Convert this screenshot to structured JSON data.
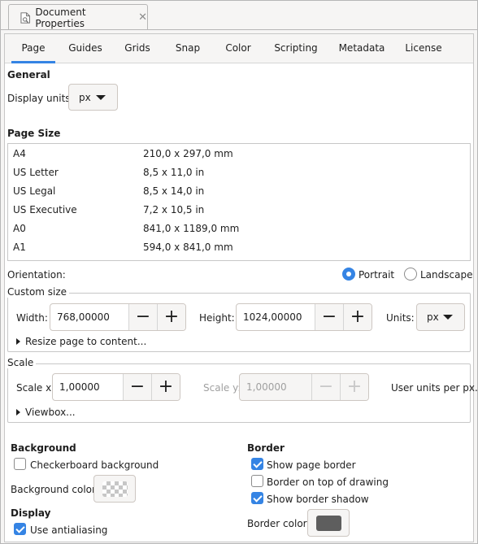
{
  "window": {
    "tab_title": "Document Properties"
  },
  "tabs": [
    "Page",
    "Guides",
    "Grids",
    "Snap",
    "Color",
    "Scripting",
    "Metadata",
    "License"
  ],
  "general": {
    "heading": "General",
    "display_units_label": "Display units:",
    "display_units_value": "px"
  },
  "page_size": {
    "heading": "Page Size",
    "rows": [
      {
        "name": "A4",
        "size": "210,0 x 297,0 mm"
      },
      {
        "name": "US Letter",
        "size": "8,5 x 11,0 in"
      },
      {
        "name": "US Legal",
        "size": "8,5 x 14,0 in"
      },
      {
        "name": "US Executive",
        "size": "7,2 x 10,5 in"
      },
      {
        "name": "A0",
        "size": "841,0 x 1189,0 mm"
      },
      {
        "name": "A1",
        "size": "594,0 x 841,0 mm"
      }
    ]
  },
  "orientation": {
    "label": "Orientation:",
    "portrait": "Portrait",
    "landscape": "Landscape",
    "selected": "portrait"
  },
  "custom_size": {
    "title": "Custom size",
    "width_label": "Width:",
    "width_value": "768,00000",
    "height_label": "Height:",
    "height_value": "1024,00000",
    "units_label": "Units:",
    "units_value": "px",
    "resize_label": "Resize page to content..."
  },
  "scale": {
    "title": "Scale",
    "scale_x_label": "Scale x:",
    "scale_x_value": "1,00000",
    "scale_y_label": "Scale y:",
    "scale_y_value": "1,00000",
    "user_units_label": "User units per px.",
    "viewbox_label": "Viewbox..."
  },
  "background": {
    "heading": "Background",
    "checkerboard_label": "Checkerboard background",
    "checkerboard_checked": false,
    "color_label": "Background color:"
  },
  "display": {
    "heading": "Display",
    "antialiasing_label": "Use antialiasing",
    "antialiasing_checked": true
  },
  "border": {
    "heading": "Border",
    "show_border_label": "Show page border",
    "show_border_checked": true,
    "border_on_top_label": "Border on top of drawing",
    "border_on_top_checked": false,
    "show_shadow_label": "Show border shadow",
    "show_shadow_checked": true,
    "color_label": "Border color:",
    "color": "#5e5e5e"
  },
  "colors": {
    "accent": "#3584e4",
    "minus": "−",
    "plus": "+"
  }
}
